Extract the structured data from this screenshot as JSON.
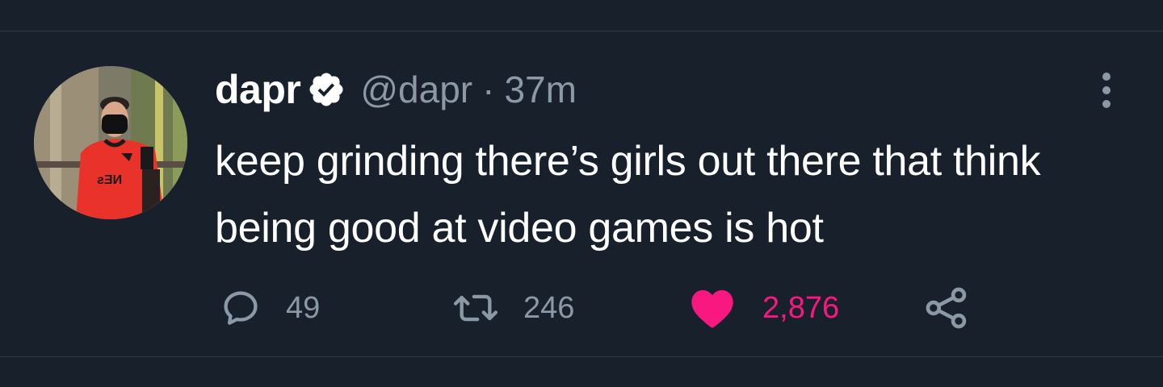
{
  "tweet": {
    "author": {
      "display_name": "dapr",
      "handle": "@dapr",
      "verified": true,
      "avatar_alt": "profile photo"
    },
    "separator": "·",
    "time": "37m",
    "text": "keep grinding there’s girls out there that think being good at video games is hot",
    "actions": {
      "reply": {
        "icon": "reply-icon",
        "count": "49"
      },
      "retweet": {
        "icon": "retweet-icon",
        "count": "246"
      },
      "like": {
        "icon": "heart-icon",
        "count": "2,876",
        "liked": true,
        "color": "#f91880"
      },
      "share": {
        "icon": "share-icon"
      }
    },
    "more_icon": "more-icon"
  },
  "colors": {
    "background": "#17202b",
    "text": "#ffffff",
    "secondary": "#8b98a5",
    "like": "#f91880"
  }
}
